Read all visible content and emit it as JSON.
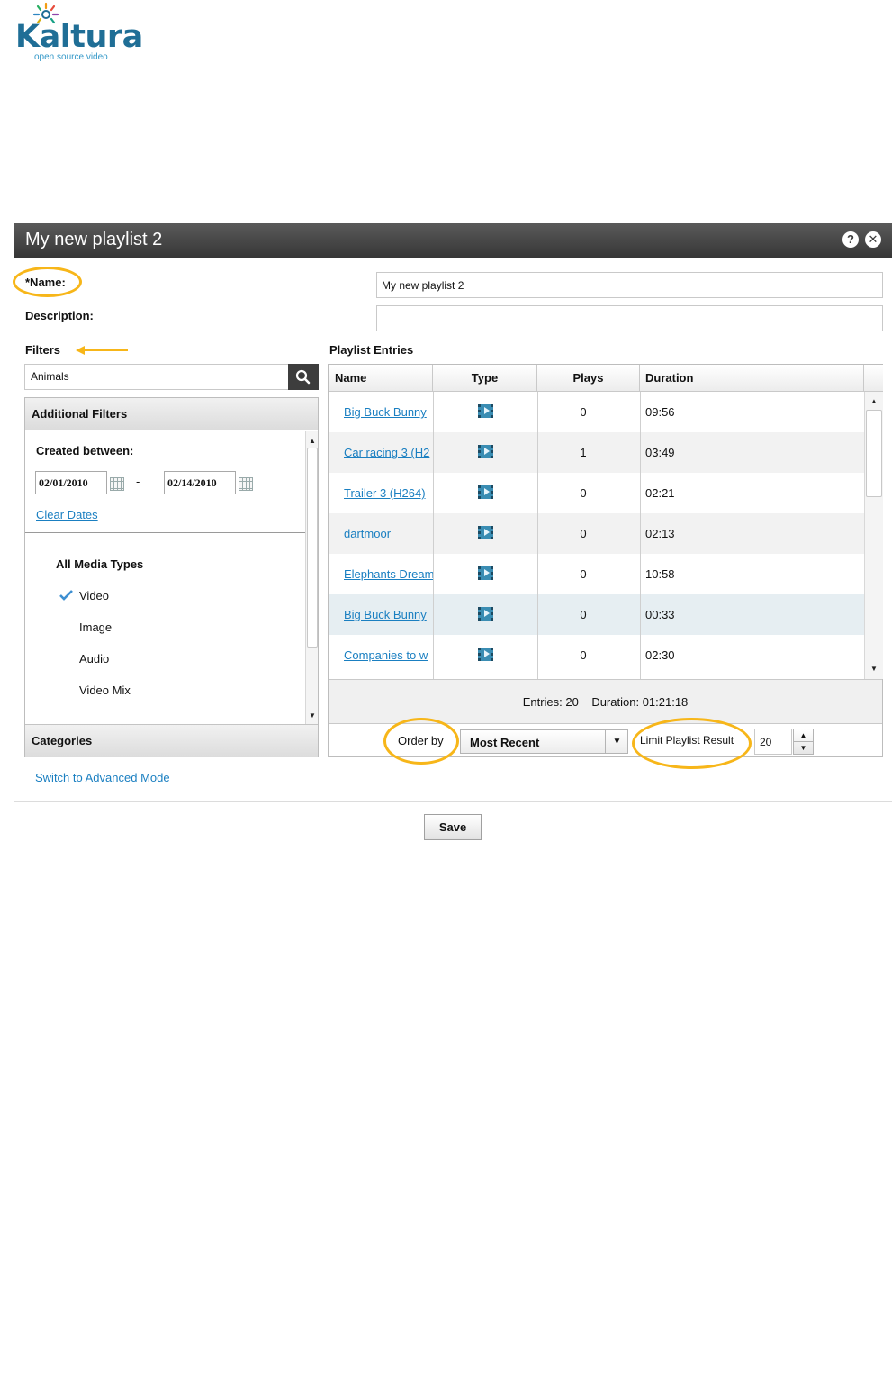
{
  "logo": {
    "name": "Kaltura",
    "tagline": "open source video"
  },
  "window": {
    "title": "My new playlist 2",
    "help_icon": "question-icon",
    "close_icon": "close-icon"
  },
  "form": {
    "name_label": "*Name:",
    "name_value": "My new playlist 2",
    "description_label": "Description:",
    "description_value": ""
  },
  "filters": {
    "heading": "Filters",
    "search_value": "Animals",
    "additional_header": "Additional Filters",
    "created_between_label": "Created between:",
    "date_from": "02/01/2010",
    "date_sep": "-",
    "date_to": "02/14/2010",
    "clear_dates": "Clear Dates",
    "media_types_label": "All Media Types",
    "media_types": [
      {
        "label": "Video",
        "checked": true
      },
      {
        "label": "Image",
        "checked": false
      },
      {
        "label": "Audio",
        "checked": false
      },
      {
        "label": "Video Mix",
        "checked": false
      }
    ],
    "categories_header": "Categories",
    "advanced_link": "Switch to Advanced Mode"
  },
  "playlist": {
    "heading": "Playlist Entries",
    "columns": [
      "Name",
      "Type",
      "Plays",
      "Duration"
    ],
    "rows": [
      {
        "name": "Big Buck Bunny",
        "type": "video",
        "plays": "0",
        "duration": "09:56"
      },
      {
        "name": "Car racing 3 (H2",
        "type": "video",
        "plays": "1",
        "duration": "03:49"
      },
      {
        "name": "Trailer 3 (H264)",
        "type": "video",
        "plays": "0",
        "duration": "02:21"
      },
      {
        "name": "dartmoor",
        "type": "video",
        "plays": "0",
        "duration": "02:13"
      },
      {
        "name": "Elephants Dream",
        "type": "video",
        "plays": "0",
        "duration": "10:58"
      },
      {
        "name": "Big Buck Bunny",
        "type": "video",
        "plays": "0",
        "duration": "00:33"
      },
      {
        "name": "Companies to w",
        "type": "video",
        "plays": "0",
        "duration": "02:30"
      }
    ],
    "summary": {
      "entries_label": "Entries:",
      "entries_value": "20",
      "duration_label": "Duration:",
      "duration_value": "01:21:18"
    },
    "order_by_label": "Order by",
    "order_by_value": "Most Recent",
    "limit_label": "Limit Playlist Result",
    "limit_value": "20"
  },
  "actions": {
    "save": "Save"
  },
  "colors": {
    "annotation": "#f7b619",
    "link": "#1a7fc1",
    "titlebar": "#3e3e3e"
  }
}
